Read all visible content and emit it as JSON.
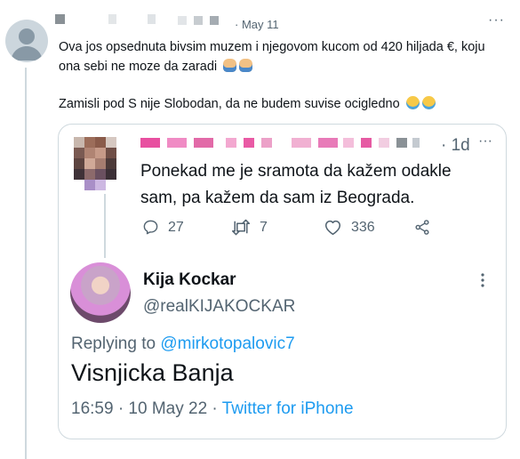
{
  "outer_tweet": {
    "date": "· May 11",
    "more_icon": "more-dots-icon",
    "line1_text": "Ova jos opsednuta bivsim muzem i njegovom kucom od 420 hiljada €, koju",
    "line2_text": "ona sebi ne moze da zaradi",
    "line3_text": "Zamisli pod S nije Slobodan, da ne budem suvise ocigledno"
  },
  "quoted_tweet": {
    "time": "· 1d",
    "text_line1": "Ponekad me je sramota da kažem odakle",
    "text_line2": "sam, pa kažem da sam iz Beograda.",
    "reply_count": "27",
    "retweet_count": "7",
    "like_count": "336"
  },
  "embedded_tweet": {
    "display_name": "Kija Kockar",
    "handle": "@realKIJAKOCKAR",
    "replying_prefix": "Replying to",
    "replying_handle": "@mirkotopalovic7",
    "text": "Visnjicka Banja",
    "timestamp": "16:59 · 10 May 22 ·",
    "source": "Twitter for iPhone"
  },
  "colors": {
    "accent": "#1d9bf0",
    "secondary_text": "#536471",
    "border": "#cfd9de"
  }
}
